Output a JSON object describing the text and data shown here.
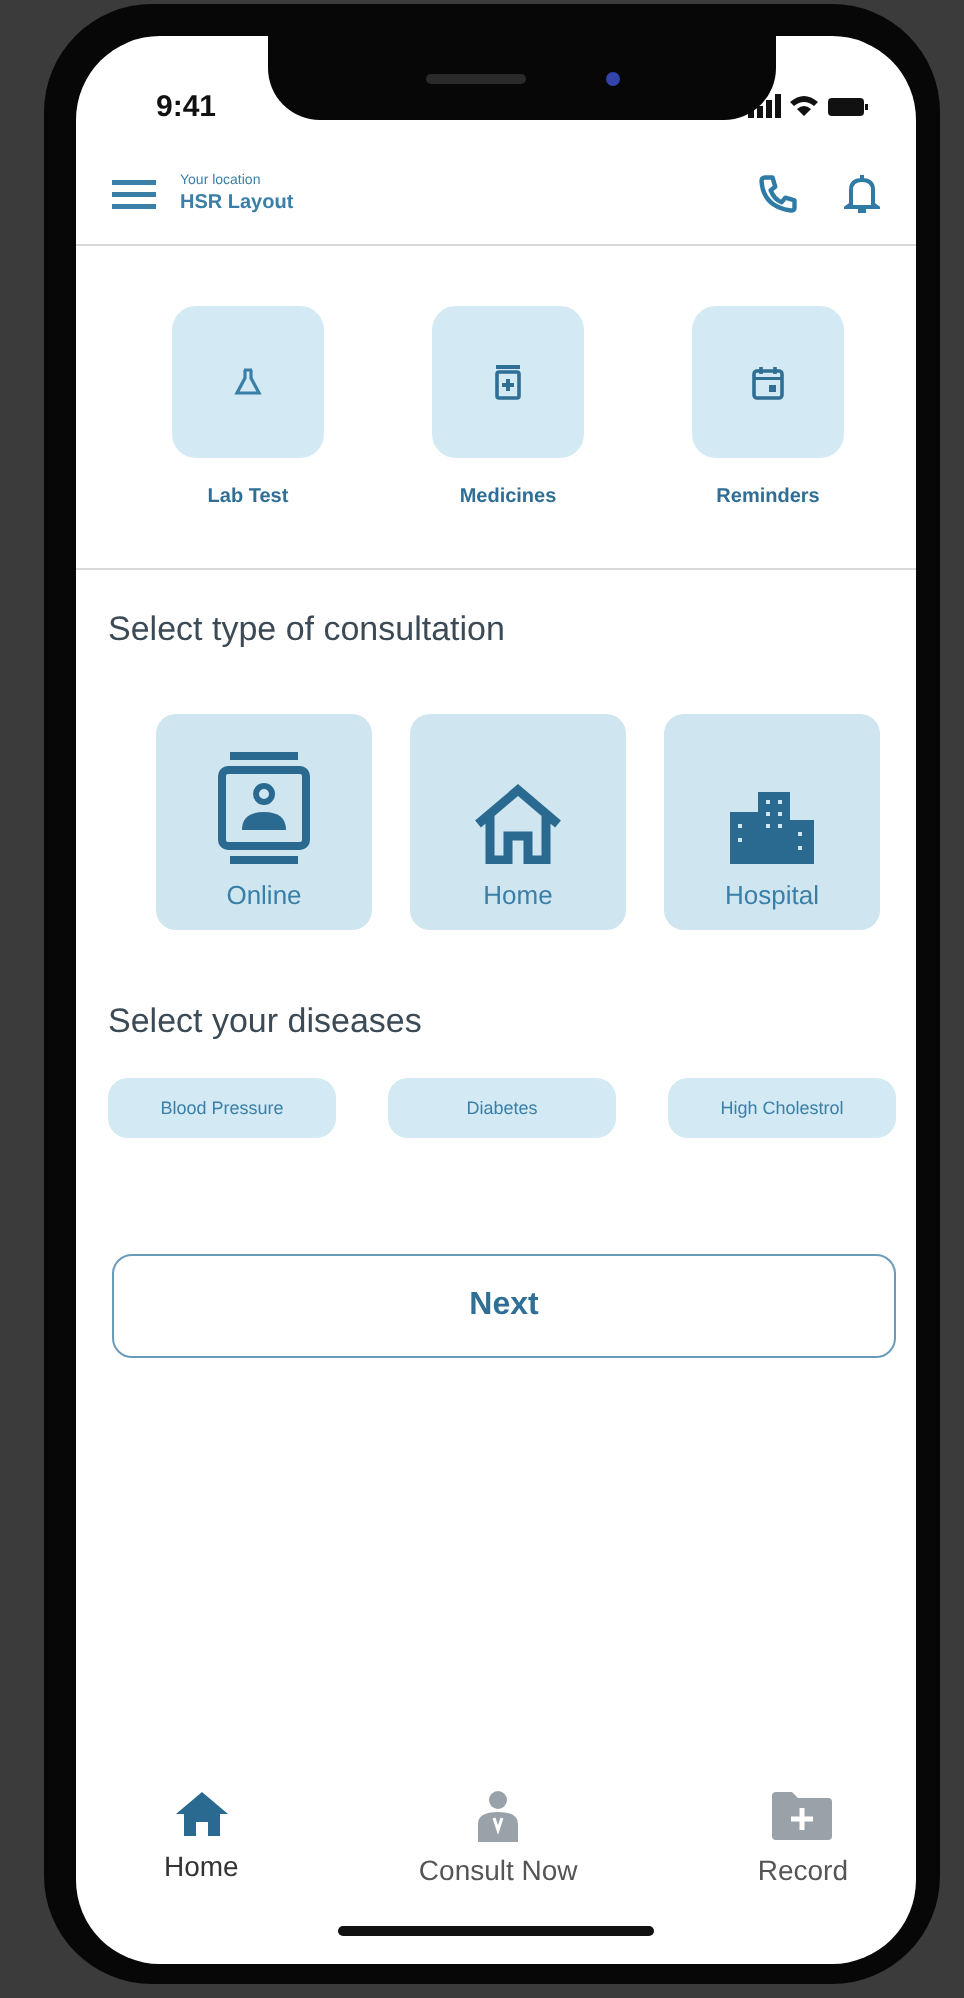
{
  "status_bar": {
    "time": "9:41"
  },
  "header": {
    "location_label": "Your location",
    "location": "HSR Layout"
  },
  "quick_actions": [
    {
      "kind": "flask",
      "label": "Lab Test"
    },
    {
      "kind": "medicine",
      "label": "Medicines"
    },
    {
      "kind": "calendar",
      "label": "Reminders"
    }
  ],
  "consultation": {
    "title": "Select type of consultation",
    "options": [
      {
        "kind": "online",
        "label": "Online"
      },
      {
        "kind": "home",
        "label": "Home"
      },
      {
        "kind": "hospital",
        "label": "Hospital"
      }
    ]
  },
  "diseases": {
    "title": "Select your diseases",
    "chips": [
      "Blood Pressure",
      "Diabetes",
      "High Cholestrol"
    ]
  },
  "next_button": "Next",
  "bottom_nav": [
    {
      "kind": "home",
      "label": "Home",
      "selected": true
    },
    {
      "kind": "doctor",
      "label": "Consult Now",
      "selected": false
    },
    {
      "kind": "folder",
      "label": "Record",
      "selected": false
    }
  ]
}
